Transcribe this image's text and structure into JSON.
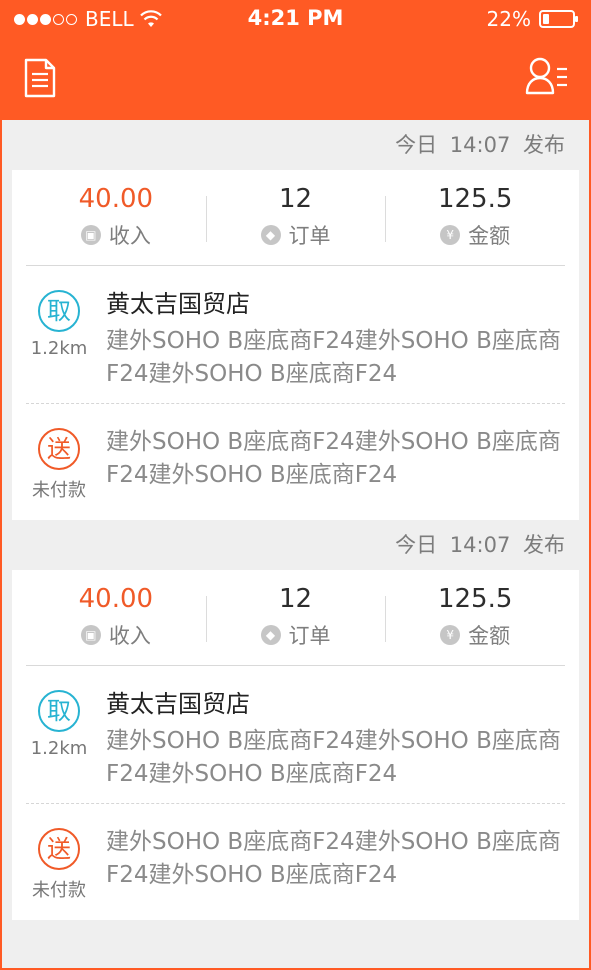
{
  "status_bar": {
    "carrier": "BELL",
    "time": "4:21 PM",
    "battery": "22%"
  },
  "colors": {
    "brand": "#ff5a24",
    "pickup": "#27b3d2",
    "delivery": "#f05a28"
  },
  "orders": [
    {
      "publish": {
        "day": "今日",
        "time": "14:07",
        "label": "发布"
      },
      "stats": [
        {
          "value": "40.00",
          "label": "收入",
          "icon": "wallet-icon"
        },
        {
          "value": "12",
          "label": "订单",
          "icon": "tag-icon"
        },
        {
          "value": "125.5",
          "label": "金额",
          "icon": "yen-icon"
        }
      ],
      "pickup": {
        "badge": "取",
        "distance": "1.2km",
        "store": "黄太吉国贸店",
        "address": "建外SOHO B座底商F24建外SOHO B座底商F24建外SOHO B座底商F24"
      },
      "delivery": {
        "badge": "送",
        "payment": "未付款",
        "address": "建外SOHO B座底商F24建外SOHO B座底商F24建外SOHO B座底商F24"
      }
    },
    {
      "publish": {
        "day": "今日",
        "time": "14:07",
        "label": "发布"
      },
      "stats": [
        {
          "value": "40.00",
          "label": "收入",
          "icon": "wallet-icon"
        },
        {
          "value": "12",
          "label": "订单",
          "icon": "tag-icon"
        },
        {
          "value": "125.5",
          "label": "金额",
          "icon": "yen-icon"
        }
      ],
      "pickup": {
        "badge": "取",
        "distance": "1.2km",
        "store": "黄太吉国贸店",
        "address": "建外SOHO B座底商F24建外SOHO B座底商F24建外SOHO B座底商F24"
      },
      "delivery": {
        "badge": "送",
        "payment": "未付款",
        "address": "建外SOHO B座底商F24建外SOHO B座底商F24建外SOHO B座底商F24"
      }
    }
  ]
}
